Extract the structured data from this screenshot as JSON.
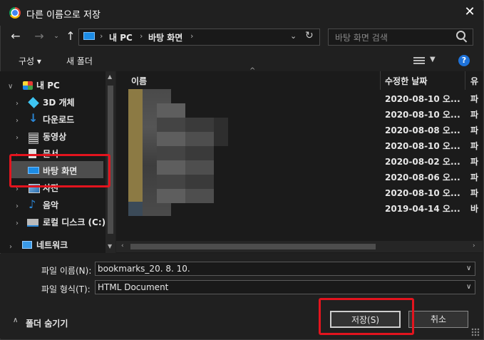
{
  "window": {
    "title": "다른 이름으로 저장"
  },
  "address": {
    "crumbs": [
      "내 PC",
      "바탕 화면"
    ]
  },
  "search": {
    "placeholder": "바탕 화면 검색"
  },
  "toolbar": {
    "organize": "구성 ▾",
    "new_folder": "새 폴더"
  },
  "nav": {
    "items": [
      {
        "label": "내 PC",
        "icon": "computer-icon"
      },
      {
        "label": "3D 개체",
        "icon": "cube-icon"
      },
      {
        "label": "다운로드",
        "icon": "download-icon"
      },
      {
        "label": "동영상",
        "icon": "video-icon"
      },
      {
        "label": "문서",
        "icon": "document-icon"
      },
      {
        "label": "바탕 화면",
        "icon": "desktop-icon"
      },
      {
        "label": "사진",
        "icon": "picture-icon"
      },
      {
        "label": "음악",
        "icon": "music-icon"
      },
      {
        "label": "로컬 디스크 (C:)",
        "icon": "disk-icon"
      },
      {
        "label": "네트워크",
        "icon": "network-icon"
      }
    ]
  },
  "filelist": {
    "columns": {
      "name": "이름",
      "date": "수정한 날짜",
      "type": "유"
    },
    "rows": [
      {
        "date": "2020-08-10 오...",
        "type": "파"
      },
      {
        "date": "2020-08-10 오...",
        "type": "파"
      },
      {
        "date": "2020-08-08 오...",
        "type": "파"
      },
      {
        "date": "2020-08-10 오...",
        "type": "파"
      },
      {
        "date": "2020-08-02 오...",
        "type": "파"
      },
      {
        "date": "2020-08-06 오...",
        "type": "파"
      },
      {
        "date": "2020-08-10 오...",
        "type": "파"
      },
      {
        "date": "2019-04-14 오...",
        "type": "바"
      }
    ]
  },
  "form": {
    "filename_label": "파일 이름(N):",
    "filename_value": "bookmarks_20. 8. 10.",
    "filetype_label": "파일 형식(T):",
    "filetype_value": "HTML Document"
  },
  "footer": {
    "hide_folders": "폴더 숨기기",
    "save": "저장(S)",
    "cancel": "취소"
  },
  "colors": {
    "highlight": "#e3141e",
    "accent": "#1c8ce6"
  }
}
